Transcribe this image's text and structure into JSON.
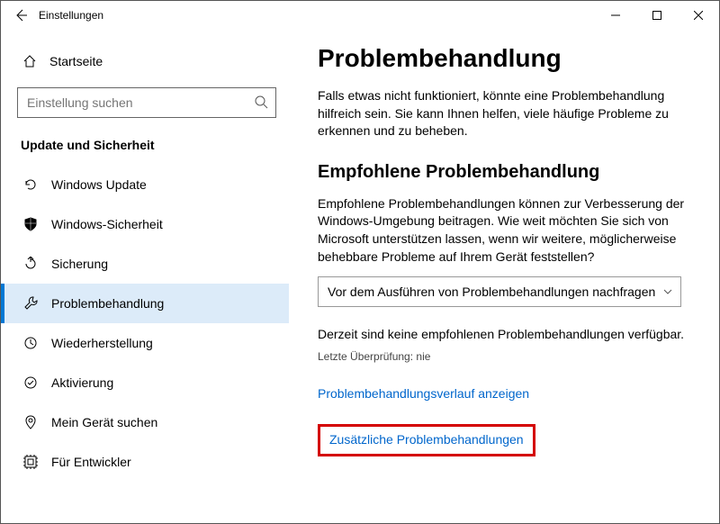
{
  "window": {
    "title": "Einstellungen"
  },
  "sidebar": {
    "home": "Startseite",
    "search_placeholder": "Einstellung suchen",
    "section": "Update und Sicherheit",
    "items": [
      {
        "label": "Windows Update"
      },
      {
        "label": "Windows-Sicherheit"
      },
      {
        "label": "Sicherung"
      },
      {
        "label": "Problembehandlung"
      },
      {
        "label": "Wiederherstellung"
      },
      {
        "label": "Aktivierung"
      },
      {
        "label": "Mein Gerät suchen"
      },
      {
        "label": "Für Entwickler"
      }
    ]
  },
  "main": {
    "title": "Problembehandlung",
    "intro": "Falls etwas nicht funktioniert, könnte eine Problembehandlung hilfreich sein. Sie kann Ihnen helfen, viele häufige Probleme zu erkennen und zu beheben.",
    "recommended_title": "Empfohlene Problembehandlung",
    "recommended_desc": "Empfohlene Problembehandlungen können zur Verbesserung der Windows-Umgebung beitragen. Wie weit möchten Sie sich von Microsoft unterstützen lassen, wenn wir weitere, möglicherweise behebbare Probleme auf Ihrem Gerät feststellen?",
    "dropdown_value": "Vor dem Ausführen von Problembehandlungen nachfragen",
    "status": "Derzeit sind keine empfohlenen Problembehandlungen verfügbar.",
    "last_check": "Letzte Überprüfung: nie",
    "link_history": "Problembehandlungsverlauf anzeigen",
    "link_additional": "Zusätzliche Problembehandlungen"
  }
}
